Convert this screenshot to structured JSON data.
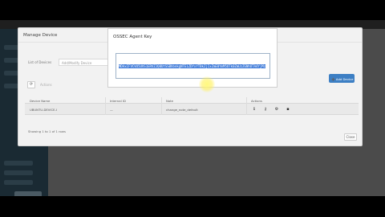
{
  "modal": {
    "title": "Manage Device",
    "close_icon": "close-icon",
    "list_label": "List of Devices",
    "filter_value": "Add/Modify Device",
    "add_button": "➕ Add Device",
    "bulk_label": "Actions",
    "columns": [
      "Device Name",
      "Internal ID",
      "Note",
      "Actions"
    ],
    "row": {
      "device_name": "UBUNTU-DEVICE-I",
      "internal_id": "—",
      "note": "change_note_default"
    },
    "action_icons": [
      "info-icon",
      "key-icon",
      "gear-icon",
      "trash-icon"
    ],
    "showing": "Showing 1 to 1 of 1 rows",
    "close_button": "Close"
  },
  "popup": {
    "title": "OSSEC Agent Key",
    "key": "MDAxIFVCVU5UVS1ERVZJQ0UtSSBhbnkgNTE1ZDYxYTBkZjIxZmE0YmM5OTk0ZmUzZGNhOTA4YjMzOWI3ZWM1ZmQ0NjY0ZjMwYzgxN2FhNTIzZjU0YWNmMjk="
  },
  "sidebar": {
    "items": 8
  }
}
